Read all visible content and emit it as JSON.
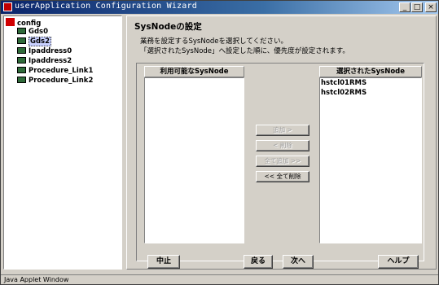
{
  "window": {
    "title": "userApplication Configuration Wizard",
    "minimize_glyph": "_",
    "maximize_glyph": "□",
    "close_glyph": "×"
  },
  "tree": {
    "root": "config",
    "items": [
      {
        "label": "Gds0",
        "selected": false
      },
      {
        "label": "Gds2",
        "selected": true
      },
      {
        "label": "Ipaddress0",
        "selected": false
      },
      {
        "label": "Ipaddress2",
        "selected": false
      },
      {
        "label": "Procedure_Link1",
        "selected": false
      },
      {
        "label": "Procedure_Link2",
        "selected": false
      }
    ]
  },
  "main": {
    "heading": "SysNodeの設定",
    "desc_line1": "業務を設定するSysNodeを選択してください。",
    "desc_line2": "「選択されたSysNode」へ設定した順に、優先度が設定されます。",
    "available_label": "利用可能なSysNode",
    "selected_label": "選択されたSysNode",
    "selected_items": [
      "hstcl01RMS",
      "hstcl02RMS"
    ],
    "add_button": "追加 >",
    "remove_button": "< 削除",
    "add_all_button": "全て追加 >>",
    "remove_all_button": "<< 全て削除"
  },
  "footer": {
    "cancel": "中止",
    "back": "戻る",
    "next": "次へ",
    "help": "ヘルプ"
  },
  "status": "Java Applet Window"
}
